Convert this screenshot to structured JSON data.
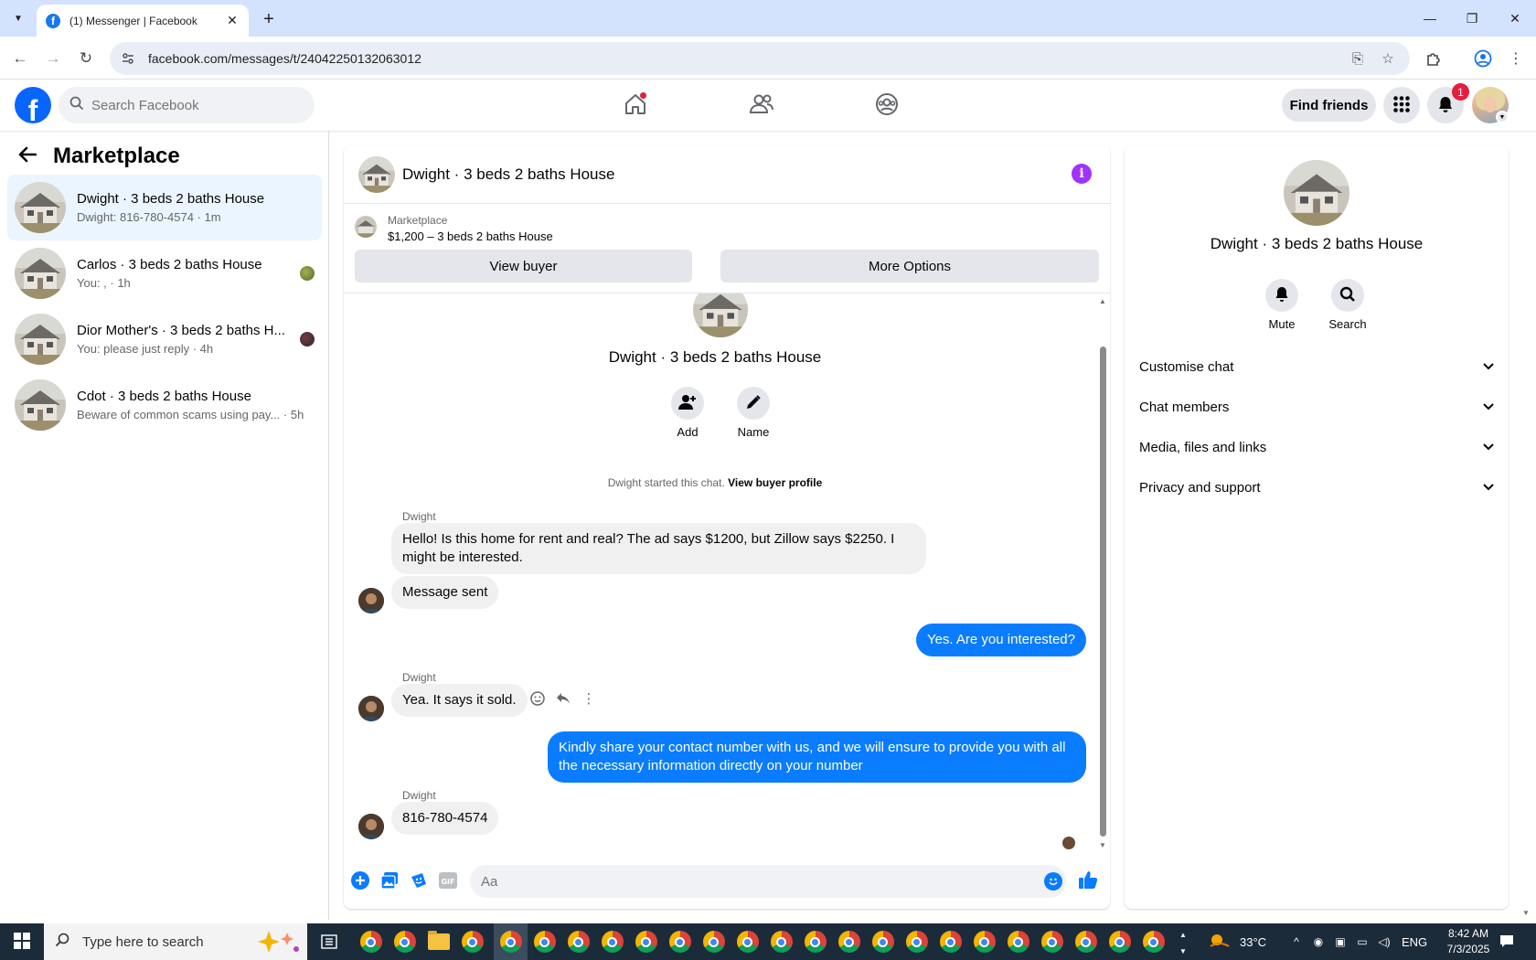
{
  "browser": {
    "tab_title": "(1) Messenger | Facebook",
    "url": "facebook.com/messages/t/24042250132063012"
  },
  "fb_header": {
    "logo_letter": "f",
    "search_placeholder": "Search Facebook",
    "find_friends_label": "Find friends",
    "notification_count": "1",
    "brand_color": "#0866ff"
  },
  "left_pane": {
    "title": "Marketplace",
    "conversations": [
      {
        "name": "Dwight · 3 beds 2 baths House",
        "preview": "Dwight: 816-780-4574 · 1m",
        "active": true
      },
      {
        "name": "Carlos · 3 beds 2 baths House",
        "preview": "You: , · 1h"
      },
      {
        "name": "Dior Mother's · 3 beds 2 baths H...",
        "preview": "You: please just reply · 4h"
      },
      {
        "name": "Cdot · 3 beds 2 baths House",
        "preview": "Beware of common scams using pay...  · 5h"
      }
    ]
  },
  "chat": {
    "title": "Dwight · 3 beds 2 baths House",
    "marketplace_label": "Marketplace",
    "listing_price": "$1,200 – 3 beds 2 baths House",
    "view_buyer_label": "View buyer",
    "more_options_label": "More Options",
    "intro_title": "Dwight · 3 beds 2 baths House",
    "add_label": "Add",
    "name_label": "Name",
    "started_text": "Dwight started this chat.",
    "view_profile_link": "View buyer profile",
    "sender_name": "Dwight",
    "messages": {
      "m1": "Hello! Is this home for rent and real? The ad says $1200, but Zillow says $2250. I might be interested.",
      "m2": "Message sent",
      "m3": "Yes. Are you interested?",
      "m4": "Yea. It says it sold.",
      "m5": "Kindly share your contact number with us, and we will ensure to provide you with all the necessary information directly on your number",
      "m6": "816-780-4574"
    },
    "composer_placeholder": "Aa",
    "outgoing_color": "#0a7cff"
  },
  "right_pane": {
    "title": "Dwight · 3 beds 2 baths House",
    "mute_label": "Mute",
    "search_label": "Search",
    "sections": [
      "Customise chat",
      "Chat members",
      "Media, files and links",
      "Privacy and support"
    ]
  },
  "taskbar": {
    "search_placeholder": "Type here to search",
    "weather": "33°C",
    "language": "ENG",
    "time": "8:42 AM",
    "date": "7/3/2025"
  }
}
